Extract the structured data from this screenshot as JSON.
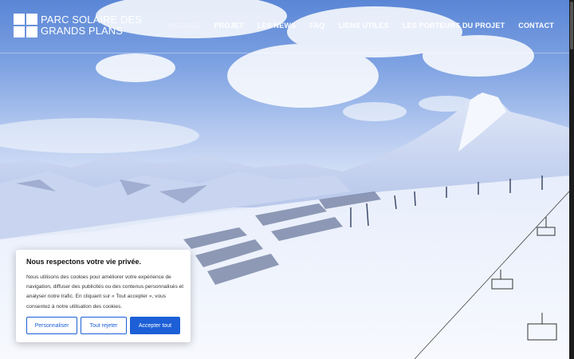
{
  "site": {
    "logo_line1": "PARC SOLAIRE DES",
    "logo_line2": "GRANDS PLANS"
  },
  "nav": {
    "items": [
      "ACCUEIL",
      "PROJET",
      "LES NEWS",
      "FAQ",
      "LIENS UTILES",
      "LES PORTEURS DU PROJET",
      "CONTACT"
    ],
    "active": "ACCUEIL"
  },
  "cookie_banner": {
    "title": "Nous respectons votre vie privée.",
    "body": "Nous utilisons des cookies pour améliorer votre expérience de navigation, diffuser des publicités ou des contenus personnalisés et analyser notre trafic. En cliquant sur « Tout accepter », vous consentez à notre utilisation des cookies.",
    "customize_label": "Personnaliser",
    "reject_label": "Tout rejeter",
    "accept_label": "Accepter tout"
  },
  "colors": {
    "accent": "#1c5fd6",
    "header_text": "#ffffff"
  }
}
